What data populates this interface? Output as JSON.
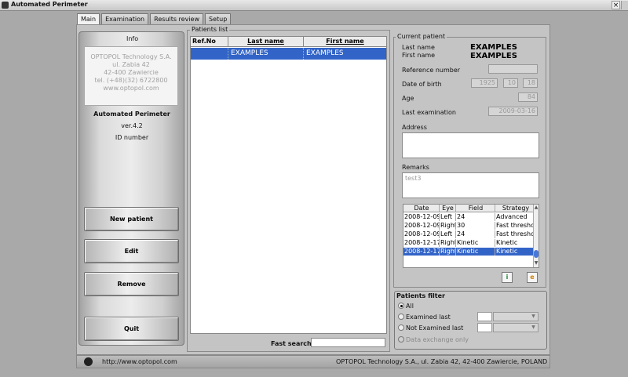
{
  "window": {
    "title": "Automated Perimeter",
    "close_label": "×"
  },
  "tabs": [
    {
      "label": "Main",
      "active": true
    },
    {
      "label": "Examination",
      "active": false
    },
    {
      "label": "Results review",
      "active": false
    },
    {
      "label": "Setup",
      "active": false
    }
  ],
  "info": {
    "title": "Info",
    "lines": [
      "OPTOPOL Technology S.A.",
      "ul. Zabia 42",
      "42-400 Zawiercie",
      "tel. (+48)(32) 6722800",
      "www.optopol.com"
    ],
    "app_name": "Automated Perimeter",
    "version": "ver.4.2",
    "id_label": "ID number"
  },
  "buttons": {
    "new_patient": "New patient",
    "edit": "Edit",
    "remove": "Remove",
    "quit": "Quit"
  },
  "patients_list": {
    "legend": "Patients list",
    "columns": [
      "Ref.No",
      "Last name",
      "First name"
    ],
    "rows": [
      {
        "ref": "",
        "last": "EXAMPLES",
        "first": "EXAMPLES"
      }
    ],
    "fast_search_label": "Fast search"
  },
  "current_patient": {
    "legend": "Current patient",
    "last_name_label": "Last name",
    "first_name_label": "First name",
    "last_name": "EXAMPLES",
    "first_name": "EXAMPLES",
    "reference_label": "Reference number",
    "dob_label": "Date of birth",
    "dob_year": "1925",
    "dob_month": "10",
    "dob_day": "18",
    "age_label": "Age",
    "age": "84",
    "last_exam_label": "Last examination",
    "last_exam": "2009-03-16",
    "address_label": "Address",
    "remarks_label": "Remarks",
    "remarks": "test3"
  },
  "exams": {
    "columns": [
      "Date",
      "Eye",
      "Field",
      "Strategy"
    ],
    "rows": [
      {
        "date": "2008-12-09",
        "eye": "Left",
        "field": "24",
        "strategy": "Advanced"
      },
      {
        "date": "2008-12-09",
        "eye": "Right",
        "field": "30",
        "strategy": "Fast threshold"
      },
      {
        "date": "2008-12-09",
        "eye": "Left",
        "field": "24",
        "strategy": "Fast threshold"
      },
      {
        "date": "2008-12-17",
        "eye": "Right",
        "field": "Kinetic",
        "strategy": "Kinetic"
      },
      {
        "date": "2008-12-17",
        "eye": "Right",
        "field": "Kinetic",
        "strategy": "Kinetic"
      }
    ],
    "selected_index": 4,
    "import_icon_glyph": "i",
    "export_icon_glyph": "e"
  },
  "filter": {
    "legend": "Patients filter",
    "all": "All",
    "examined_last": "Examined last",
    "not_examined_last": "Not Examined last",
    "data_exchange_only": "Data exchange only"
  },
  "status": {
    "url": "http://www.optopol.com",
    "company": "OPTOPOL Technology S.A., ul. Zabia 42, 42-400 Zawiercie, POLAND"
  }
}
